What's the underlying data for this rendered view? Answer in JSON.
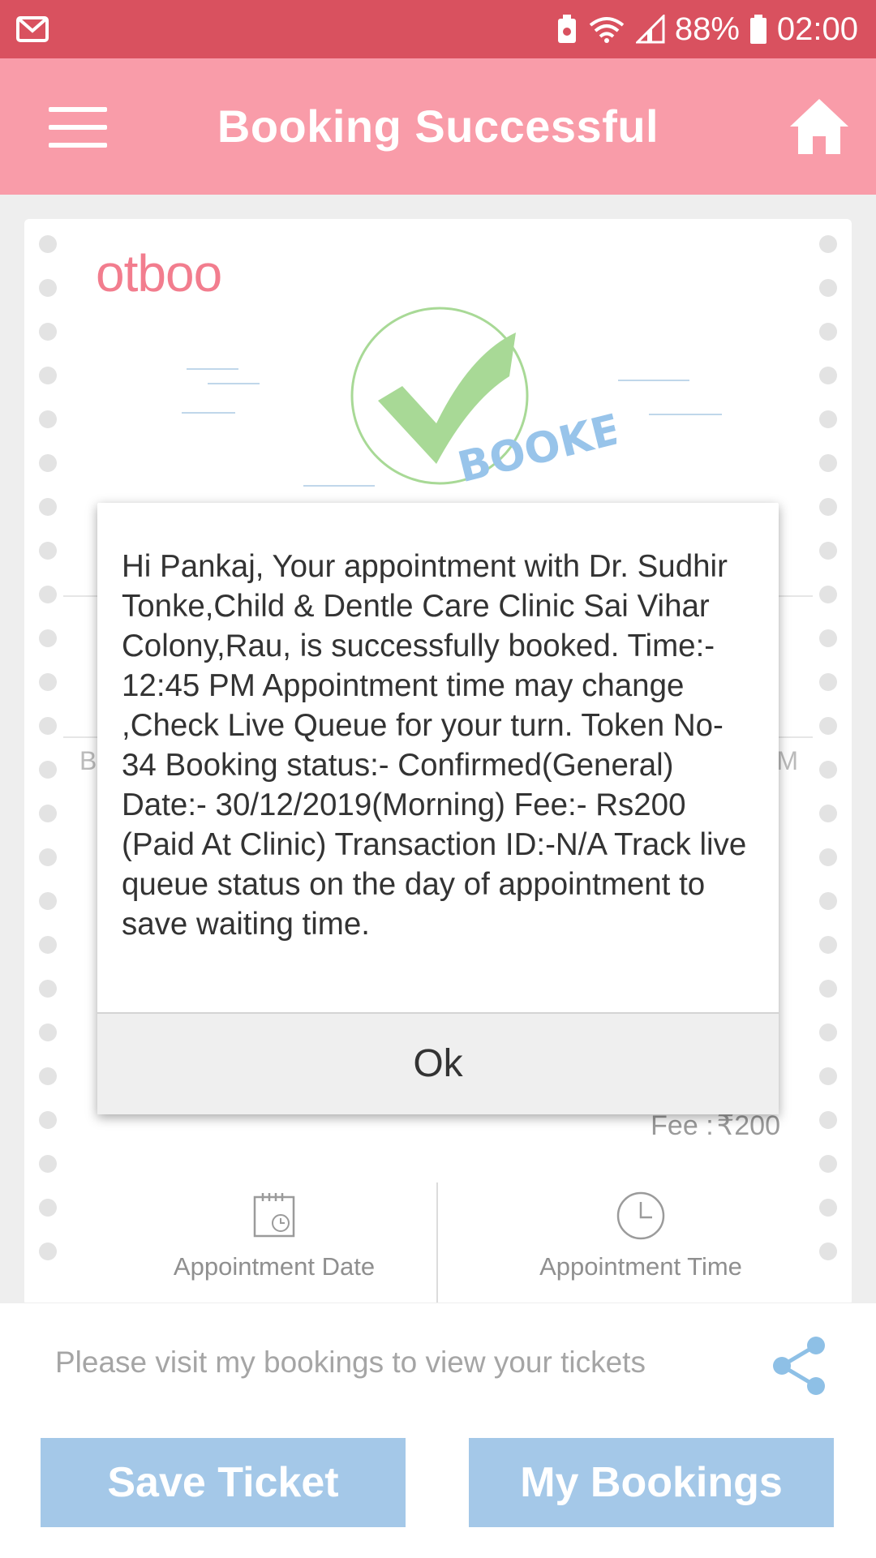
{
  "status_bar": {
    "battery": "88%",
    "time": "02:00",
    "icons": [
      "gmail-icon",
      "battery-saver-icon",
      "wifi-icon",
      "signal-icon",
      "battery-icon"
    ]
  },
  "appbar": {
    "title": "Booking Successful",
    "menu_icon": "menu-icon",
    "home_icon": "home-icon"
  },
  "ticket": {
    "logo": "otboo",
    "stamp_text": "BOOKED",
    "behind_left": "B",
    "behind_right": "M",
    "fee_label": "Fee :",
    "fee_value": "₹200",
    "appointment_date_label": "Appointment Date",
    "appointment_time_label": "Appointment Time"
  },
  "bottom": {
    "visit_text": "Please visit my bookings to view your tickets",
    "save_ticket": "Save Ticket",
    "my_bookings": "My Bookings",
    "share_icon": "share-icon"
  },
  "dialog": {
    "message": "Hi Pankaj, Your appointment with Dr. Sudhir Tonke,Child & Dentle Care Clinic Sai Vihar Colony,Rau, is successfully booked. Time:- 12:45 PM Appointment time may change ,Check Live Queue for your turn. Token No-34 Booking status:- Confirmed(General) Date:- 30/12/2019(Morning) Fee:- Rs200 (Paid At Clinic) Transaction ID:-N/A Track live queue status on the day of appointment to save waiting time.",
    "ok_label": "Ok"
  },
  "colors": {
    "status_bar": "#d9515f",
    "app_bar": "#f99ca9",
    "logo": "#f27d8e",
    "button": "#a4c8e8",
    "check": "#a8d996"
  }
}
